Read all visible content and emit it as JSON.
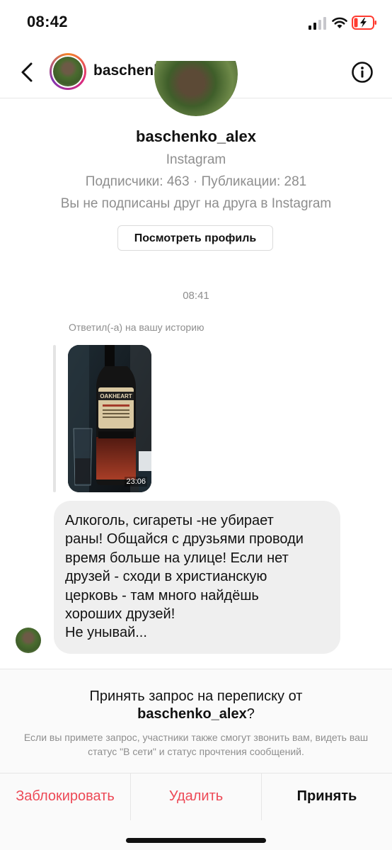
{
  "status_bar": {
    "time": "08:42",
    "battery_color": "#ff3b30"
  },
  "header": {
    "username": "baschenko_alex",
    "back_icon": "chevron-left-icon",
    "info_icon": "info-circle-icon"
  },
  "profile": {
    "username": "baschenko_alex",
    "source": "Instagram",
    "stats": "Подписчики: 463 · Публикации: 281",
    "mutual": "Вы не подписаны друг на друга в Instagram",
    "view_profile_label": "Посмотреть профиль"
  },
  "thread": {
    "timestamp": "08:41",
    "reply_caption": "Ответил(-а) на вашу историю",
    "story": {
      "duration": "23:06",
      "bottle_label": "OAKHEART"
    },
    "message": "Алкоголь, сигареты -не убирает\nраны! Общайся с друзьями проводи\nвремя больше на улице! Если нет\nдрузей - сходи в христианскую\nцерковь - там много найдёшь\nхороших друзей!\nНе унывай..."
  },
  "request": {
    "title_prefix": "Принять запрос на переписку от",
    "title_user": "baschenko_alex",
    "title_suffix": "?",
    "description": "Если вы примете запрос, участники также смогут звонить вам, видеть ваш статус \"В сети\" и статус прочтения сообщений.",
    "block_label": "Заблокировать",
    "delete_label": "Удалить",
    "accept_label": "Принять",
    "danger_color": "#ed4956"
  }
}
